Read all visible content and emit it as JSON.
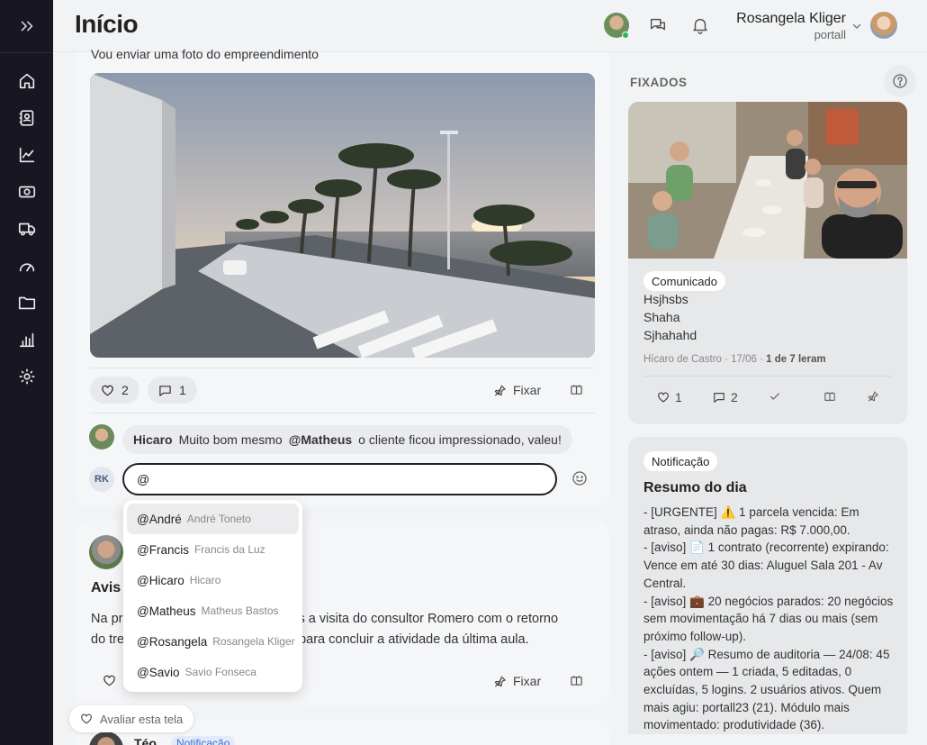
{
  "sidebar": {
    "toggle_icon": "double-chevron-right-icon",
    "items": [
      {
        "name": "home",
        "icon": "home-icon"
      },
      {
        "name": "contacts",
        "icon": "contact-book-icon"
      },
      {
        "name": "analytics",
        "icon": "line-chart-icon"
      },
      {
        "name": "finance",
        "icon": "money-icon"
      },
      {
        "name": "logistics",
        "icon": "truck-icon"
      },
      {
        "name": "dashboard",
        "icon": "gauge-icon"
      },
      {
        "name": "files",
        "icon": "folder-icon"
      },
      {
        "name": "reports",
        "icon": "bar-chart-icon"
      },
      {
        "name": "settings",
        "icon": "gear-icon"
      }
    ]
  },
  "header": {
    "title": "Início",
    "user_name": "Rosangela Kliger",
    "user_sub": "portall"
  },
  "feed": {
    "post1": {
      "text": "Vou enviar uma foto do empreendimento",
      "likes": "2",
      "comments": "1",
      "pin_label": "Fixar",
      "comment": {
        "author": "Hicaro",
        "text_before": "Muito bom mesmo",
        "mention": "@Matheus",
        "text_after": "o cliente ficou impressionado, valeu!"
      },
      "reply_initials": "RK",
      "reply_value": "@"
    },
    "post2": {
      "title_visible": "Avis",
      "line1_start": "Na pr",
      "line1_end": "os a visita do consultor Romero com o retorno",
      "line2_start": "do tre",
      "line2_end": "para concluir a atividade da última aula.",
      "pin_label": "Fixar"
    },
    "post3": {
      "author": "Téo",
      "badge": "Notificação"
    }
  },
  "mentions": [
    {
      "handle": "@André",
      "name": "André Toneto"
    },
    {
      "handle": "@Francis",
      "name": "Francis da Luz"
    },
    {
      "handle": "@Hicaro",
      "name": "Hicaro"
    },
    {
      "handle": "@Matheus",
      "name": "Matheus Bastos"
    },
    {
      "handle": "@Rosangela",
      "name": "Rosangela Kliger"
    },
    {
      "handle": "@Savio",
      "name": "Savio Fonseca"
    }
  ],
  "rate_button": "Avaliar esta tela",
  "pinned": {
    "label": "FIXADOS",
    "card": {
      "badge": "Comunicado",
      "lines": [
        "Hsjhsbs",
        "Shaha",
        "Sjhahahd"
      ],
      "meta": "Hícaro de Castro · 17/06 ·",
      "read": "1 de 7 leram",
      "likes": "1",
      "comments": "2"
    }
  },
  "notification": {
    "badge": "Notificação",
    "title": "Resumo do dia",
    "paragraphs": [
      "- [URGENTE] ⚠️ 1 parcela vencida: Em atraso, ainda não pagas: R$ 7.000,00.",
      "- [aviso] 📄 1 contrato (recorrente) expirando: Vence em até 30 dias: Aluguel Sala 201 - Av Central.",
      "- [aviso] 💼 20 negócios parados: 20 negócios sem movimentação há 7 dias ou mais (sem próximo follow-up).",
      "- [aviso] 🔎 Resumo de auditoria — 24/08: 45 ações ontem — 1 criada, 5 editadas, 0 excluídas, 5 logins. 2 usuários ativos. Quem mais agiu: portall23 (21). Módulo mais movimentado: produtividade (36)."
    ]
  }
}
